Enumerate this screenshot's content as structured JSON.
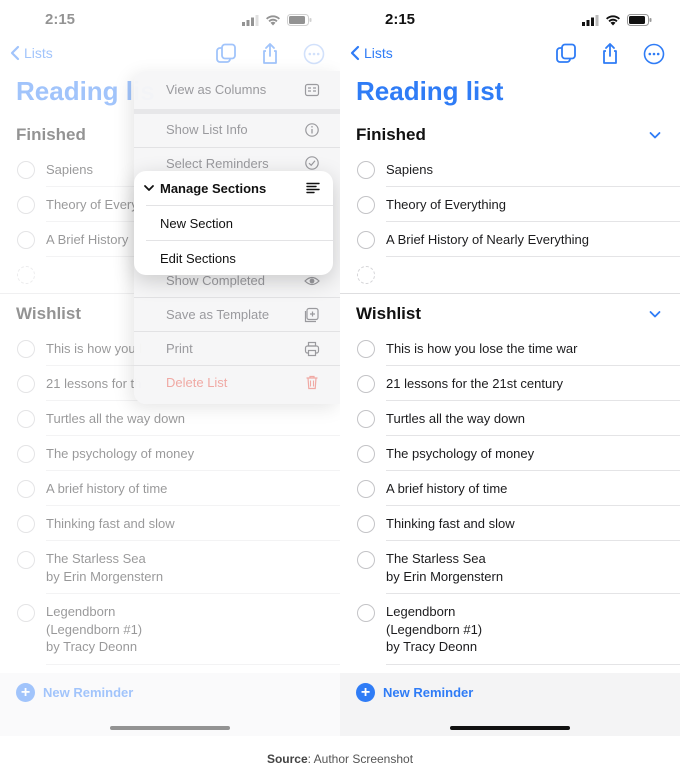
{
  "status": {
    "time": "2:15"
  },
  "nav": {
    "back_label": "Lists"
  },
  "list_title": "Reading list",
  "left_title_visible": "Reading lis",
  "sections": [
    {
      "name": "Finished",
      "items": [
        "Sapiens",
        "Theory of Everything",
        "A Brief History of Nearly Everything"
      ]
    },
    {
      "name": "Wishlist",
      "items": [
        "This is how you lose the time war",
        "21 lessons for the 21st century",
        "Turtles all the way down",
        "The psychology of money",
        "A brief history of time",
        "Thinking fast and slow",
        "The Starless Sea\nby Erin Morgenstern",
        "Legendborn\n(Legendborn #1)\nby Tracy Deonn"
      ]
    }
  ],
  "left_truncated": {
    "finished": [
      "Sapiens",
      "Theory of Every",
      "A Brief History"
    ],
    "wishlist": [
      "This is how you l",
      "21 lessons for th"
    ]
  },
  "menu": {
    "items": [
      "View as Columns",
      "Show List Info",
      "Select Reminders",
      "Show Completed",
      "Save as Template",
      "Print",
      "Delete List"
    ],
    "submenu": {
      "title": "Manage Sections",
      "items": [
        "New Section",
        "Edit Sections"
      ]
    }
  },
  "footer": {
    "new_reminder": "New Reminder"
  },
  "caption": {
    "label": "Source",
    "text": ": Author Screenshot"
  },
  "colors": {
    "accent": "#2f7cf6",
    "destructive": "#f0a9a4"
  }
}
